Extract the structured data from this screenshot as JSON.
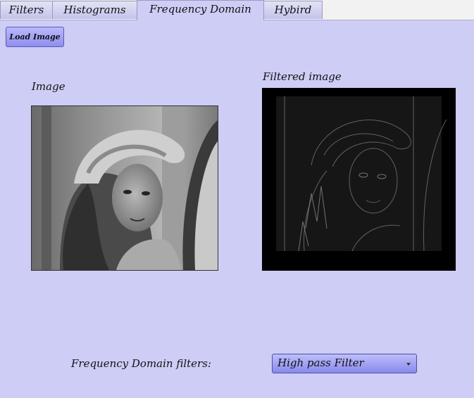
{
  "tabs": [
    {
      "label": "Filters"
    },
    {
      "label": "Histograms"
    },
    {
      "label": "Frequency Domain",
      "active": true
    },
    {
      "label": "Hybird"
    }
  ],
  "toolbar": {
    "load_label": "Load Image"
  },
  "panels": {
    "original_label": "Image",
    "filtered_label": "Filtered image"
  },
  "filters": {
    "label": "Frequency Domain filters:",
    "selected": "High pass Filter"
  }
}
